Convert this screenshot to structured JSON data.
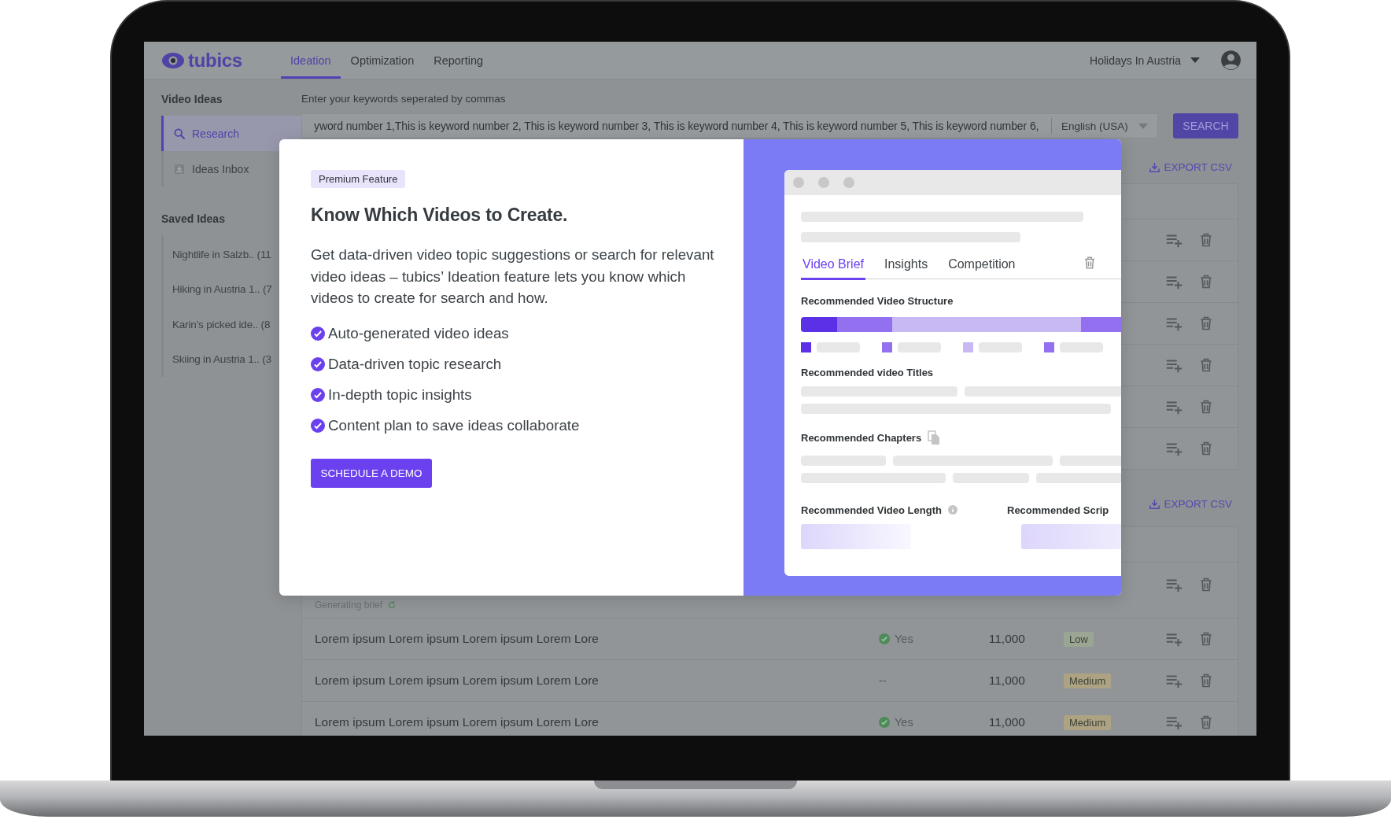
{
  "nav": {
    "logo": "tubics",
    "tabs": [
      {
        "label": "Ideation",
        "selected": true
      },
      {
        "label": "Optimization",
        "selected": false
      },
      {
        "label": "Reporting",
        "selected": false
      }
    ],
    "workspace": "Holidays In Austria"
  },
  "sidebar": {
    "sections": [
      {
        "title": "Video Ideas",
        "items": [
          {
            "label": "Research",
            "selected": true
          },
          {
            "label": "Ideas Inbox",
            "selected": false
          }
        ]
      },
      {
        "title": "Saved Ideas",
        "items": [
          {
            "label": "Nightlife in Salzb.. (11",
            "selected": false
          },
          {
            "label": "Hiking in Austria 1.. (7",
            "selected": false
          },
          {
            "label": "Karin’s  picked ide.. (8",
            "selected": false
          },
          {
            "label": "Skiing in Austria 1.. (3",
            "selected": false
          }
        ]
      }
    ]
  },
  "keywords": {
    "label": "Enter your keywords seperated by commas",
    "value": "yword number 1,This is keyword number 2, This is keyword number 3, This is keyword number 4, This is keyword number  5, This is keyword number 6,",
    "language": "English (USA)",
    "button": "SEARCH"
  },
  "tables": [
    {
      "export": "EXPORT CSV",
      "rows": [
        {
          "kind": "covered"
        },
        {
          "kind": "covered"
        },
        {
          "kind": "covered"
        },
        {
          "kind": "covered"
        },
        {
          "kind": "covered"
        },
        {
          "kind": "covered"
        }
      ]
    },
    {
      "export": "EXPORT CSV",
      "rows": [
        {
          "kind": "generating",
          "status": "Generating brief"
        },
        {
          "kind": "idea",
          "title": "Lorem ipsum Lorem ipsum Lorem ipsum Lorem Lore",
          "confirmed": true,
          "answer": "Yes",
          "volume": "11,000",
          "tag": "Low",
          "color": "#9aa693"
        },
        {
          "kind": "idea",
          "title": "Lorem ipsum Lorem ipsum Lorem ipsum Lorem Lore",
          "confirmed": false,
          "answer": "--",
          "volume": "11,000",
          "tag": "Medium",
          "color": "#ada383"
        },
        {
          "kind": "idea",
          "title": "Lorem ipsum Lorem ipsum Lorem ipsum Lorem Lore",
          "confirmed": true,
          "answer": "Yes",
          "volume": "11,000",
          "tag": "Medium",
          "color": "#ada383"
        }
      ]
    }
  ],
  "modal": {
    "badge": "Premium Feature",
    "title": "Know Which Videos to Create.",
    "body": "Get data-driven video topic suggestions or search for relevant video ideas – tubics’ Ideation feature lets you know which videos to create for search and how.",
    "features": [
      "Auto-generated video ideas",
      "Data-driven topic research",
      "In-depth topic insights",
      "Content plan to save ideas collaborate"
    ],
    "button": "SCHEDULE A DEMO",
    "preview": {
      "tabs": [
        {
          "label": "Video Brief",
          "selected": true
        },
        {
          "label": "Insights",
          "selected": false
        },
        {
          "label": "Competition",
          "selected": false
        }
      ],
      "structure_title": "Recommended Video Structure",
      "segments": [
        {
          "color": "#5b30e6"
        },
        {
          "color": "#9270ef"
        },
        {
          "color": "#c8b9f5"
        },
        {
          "color": "#9270ef"
        }
      ],
      "titles_title": "Recommended video Titles",
      "chapters_title": "Recommended Chapters",
      "length_title": "Recommended Video Length",
      "script_title": "Recommended Scrip"
    }
  }
}
